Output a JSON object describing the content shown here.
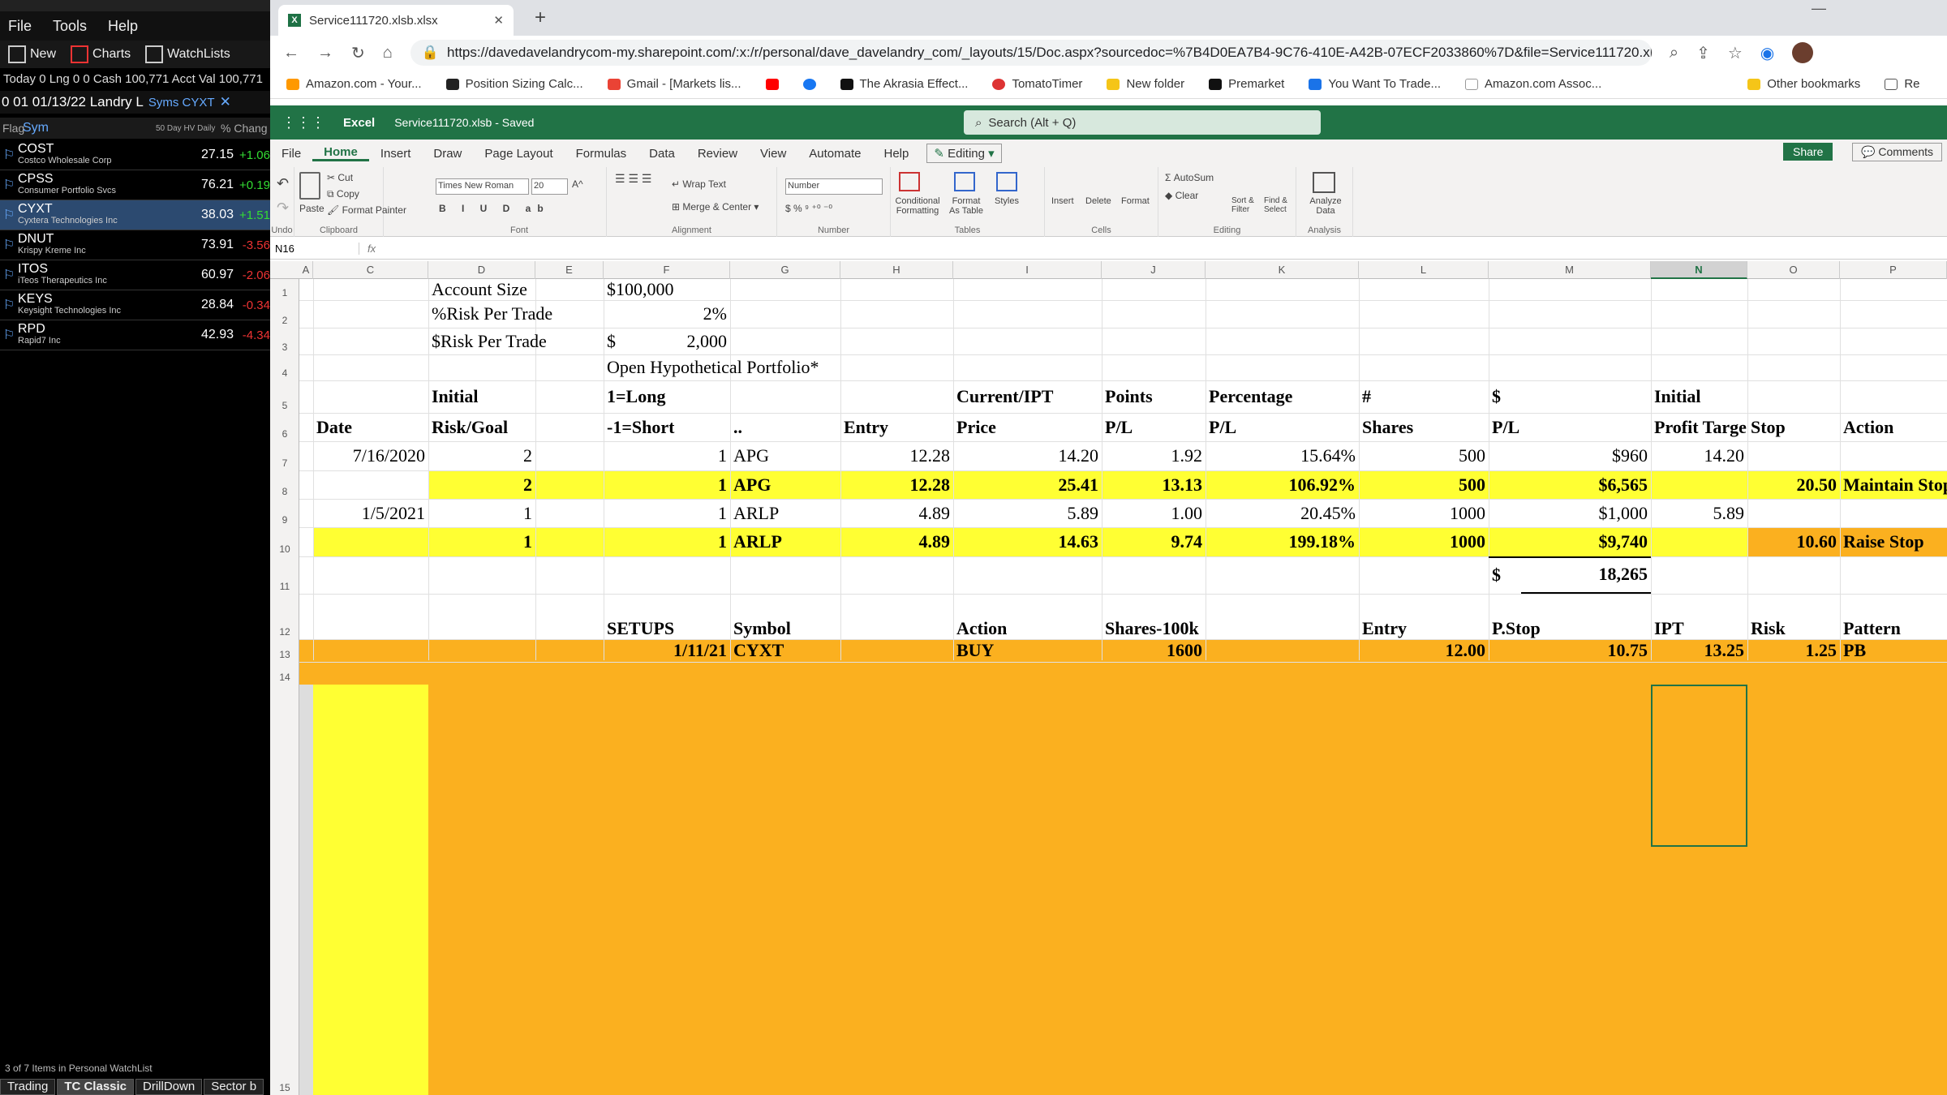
{
  "left_app": {
    "menu": [
      "File",
      "Tools",
      "Help"
    ],
    "toolbar": {
      "new": "New",
      "charts": "Charts",
      "watchlists": "WatchLists"
    },
    "status": "Today 0  Lng 0 0  Cash 100,771  Acct Val 100,771",
    "watchlist_tab": "0 01 01/13/22 Landry L",
    "watchlist_syms": "Syms  CYXT",
    "headers": {
      "flag": "Flag",
      "sym": "Sym",
      "hv": "50 Day HV Daily",
      "chg": "% Chang"
    },
    "rows": [
      {
        "sym": "COST",
        "name": "Costco Wholesale Corp",
        "price": "27.15",
        "chg": "+1.06",
        "up": true
      },
      {
        "sym": "CPSS",
        "name": "Consumer Portfolio Svcs",
        "price": "76.21",
        "chg": "+0.19",
        "up": true
      },
      {
        "sym": "CYXT",
        "name": "Cyxtera Technologies Inc",
        "price": "38.03",
        "chg": "+1.51",
        "up": true
      },
      {
        "sym": "DNUT",
        "name": "Krispy Kreme Inc",
        "price": "73.91",
        "chg": "-3.56",
        "up": false
      },
      {
        "sym": "ITOS",
        "name": "iTeos Therapeutics Inc",
        "price": "60.97",
        "chg": "-2.06",
        "up": false
      },
      {
        "sym": "KEYS",
        "name": "Keysight Technologies Inc",
        "price": "28.84",
        "chg": "-0.34",
        "up": false
      },
      {
        "sym": "RPD",
        "name": "Rapid7 Inc",
        "price": "42.93",
        "chg": "-4.34",
        "up": false
      }
    ],
    "footer": "3 of 7 Items in Personal WatchList",
    "bottom_tabs": [
      "Trading",
      "TC Classic",
      "DrillDown",
      "Sector b"
    ]
  },
  "browser": {
    "tab_title": "Service111720.xlsb.xlsx",
    "url": "https://davedavelandrycom-my.sharepoint.com/:x:/r/personal/dave_davelandry_com/_layouts/15/Doc.aspx?sourcedoc=%7B4D0EA7B4-9C76-410E-A42B-07ECF2033860%7D&file=Service111720.xl...",
    "bookmarks": [
      "Amazon.com - Your...",
      "Position Sizing Calc...",
      "Gmail - [Markets lis...",
      "",
      "",
      "The Akrasia Effect...",
      "TomatoTimer",
      "New folder",
      "Premarket",
      "You Want To Trade...",
      "Amazon.com Assoc...",
      "Other bookmarks",
      "Re"
    ]
  },
  "excel": {
    "app": "Excel",
    "file": "Service111720.xlsb - Saved",
    "search": "Search (Alt + Q)",
    "menu": [
      "File",
      "Home",
      "Insert",
      "Draw",
      "Page Layout",
      "Formulas",
      "Data",
      "Review",
      "View",
      "Automate",
      "Help"
    ],
    "editing": "Editing",
    "share": "Share",
    "comments": "Comments",
    "ribbon": {
      "undo": "Undo",
      "paste": "Paste",
      "cut": "Cut",
      "copy": "Copy",
      "format_painter": "Format Painter",
      "clipboard": "Clipboard",
      "font_name": "Times New Roman",
      "font_size": "20",
      "font": "Font",
      "wrap": "Wrap Text",
      "merge": "Merge & Center",
      "alignment": "Alignment",
      "number_format": "Number",
      "number": "Number",
      "conditional": "Conditional Formatting",
      "format_table": "Format As Table",
      "styles": "Styles",
      "tables": "Tables",
      "insert": "Insert",
      "delete": "Delete",
      "format": "Format",
      "cells": "Cells",
      "autosum": "AutoSum",
      "clear": "Clear",
      "sort": "Sort & Filter",
      "find": "Find & Select",
      "editing": "Editing",
      "analyze": "Analyze Data",
      "analysis": "Analysis"
    },
    "namebox": "N16",
    "fx": "fx",
    "columns": [
      "A",
      "C",
      "D",
      "E",
      "F",
      "G",
      "H",
      "I",
      "J",
      "K",
      "L",
      "M",
      "N",
      "O",
      "P"
    ],
    "rows_labels": [
      "1",
      "2",
      "3",
      "4",
      "5",
      "6",
      "7",
      "8",
      "9",
      "10",
      "11",
      "12",
      "13",
      "14",
      "15"
    ],
    "cells": {
      "r1": {
        "label": "Account Size",
        "value": "$100,000"
      },
      "r2": {
        "label": "%Risk Per Trade",
        "value": "2%"
      },
      "r3": {
        "label": "$Risk Per Trade",
        "dollar": "$",
        "value": "2,000"
      },
      "r4": {
        "title": "Open Hypothetical Portfolio*"
      },
      "r5": {
        "d": "Initial",
        "f": "1=Long",
        "i": "Current/IPT",
        "j": "Points",
        "k": "Percentage",
        "l": "#",
        "m": "$",
        "n": "Initial"
      },
      "r6": {
        "c": "Date",
        "d": "Risk/Goal",
        "f": "-1=Short",
        "g": "..",
        "h": "Entry",
        "i": "Price",
        "j": "P/L",
        "k": "P/L",
        "l": "Shares",
        "m": "P/L",
        "n": "Profit Targe",
        "o": "Stop",
        "p": "Action"
      },
      "r7": {
        "c": "7/16/2020",
        "d": "2",
        "f": "1",
        "g": "APG",
        "h": "12.28",
        "i": "14.20",
        "j": "1.92",
        "k": "15.64%",
        "l": "500",
        "m": "$960",
        "n": "14.20"
      },
      "r8": {
        "d": "2",
        "f": "1",
        "g": "APG",
        "h": "12.28",
        "i": "25.41",
        "j": "13.13",
        "k": "106.92%",
        "l": "500",
        "m": "$6,565",
        "o": "20.50",
        "p": "Maintain Stop"
      },
      "r9": {
        "c": "1/5/2021",
        "d": "1",
        "f": "1",
        "g": "ARLP",
        "h": "4.89",
        "i": "5.89",
        "j": "1.00",
        "k": "20.45%",
        "l": "1000",
        "m": "$1,000",
        "n": "5.89"
      },
      "r10": {
        "d": "1",
        "f": "1",
        "g": "ARLP",
        "h": "4.89",
        "i": "14.63",
        "j": "9.74",
        "k": "199.18%",
        "l": "1000",
        "m": "$9,740",
        "o": "10.60",
        "p": "Raise Stop"
      },
      "r11": {
        "dollar": "$",
        "total": "18,265"
      },
      "r12": {
        "f": "SETUPS",
        "g": "Symbol",
        "i": "Action",
        "j": "Shares-100k",
        "l": "Entry",
        "m": "P.Stop",
        "n": "IPT",
        "o": "Risk",
        "p": "Pattern"
      },
      "r13": {
        "f": "1/11/21",
        "g": "CYXT",
        "i": "BUY",
        "j": "1600",
        "l": "12.00",
        "m": "10.75",
        "n": "13.25",
        "o": "1.25",
        "p": "PB"
      }
    },
    "colors": {
      "yellow": "#ffff33",
      "orange": "#fbb01f",
      "excel_green": "#217346"
    }
  }
}
